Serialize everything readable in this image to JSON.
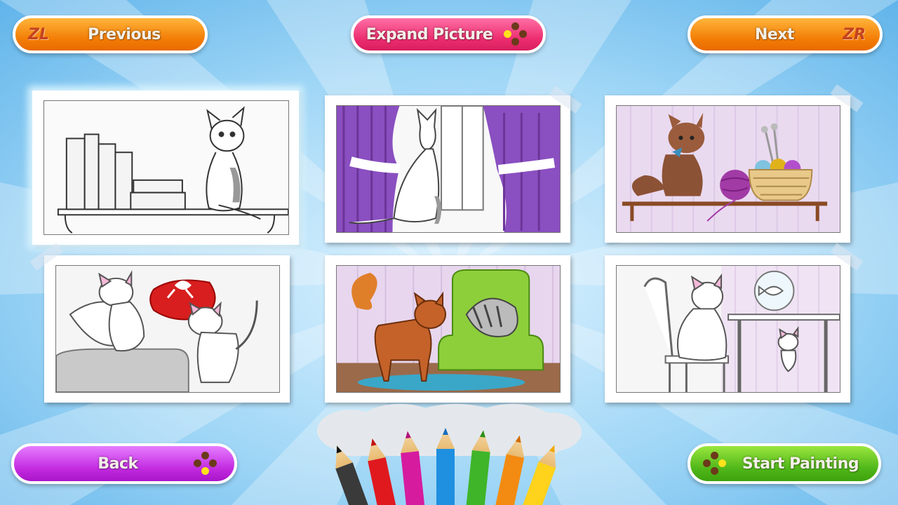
{
  "buttons": {
    "previous": {
      "label": "Previous",
      "shoulder": "ZL"
    },
    "expand": {
      "label": "Expand Picture"
    },
    "next": {
      "label": "Next",
      "shoulder": "ZR"
    },
    "back": {
      "label": "Back"
    },
    "start": {
      "label": "Start Painting"
    }
  },
  "colors": {
    "background": "#7fc4ef",
    "orange": "#f37d06",
    "pink": "#ec2d6f",
    "purple": "#c22ae0",
    "green": "#4fb619"
  },
  "pictures": [
    {
      "name": "cat-on-bookshelf",
      "selected": true
    },
    {
      "name": "cat-by-window-curtains",
      "selected": false
    },
    {
      "name": "kitten-with-yarn",
      "selected": false
    },
    {
      "name": "cats-with-pillow",
      "selected": false
    },
    {
      "name": "cats-in-armchair",
      "selected": false
    },
    {
      "name": "cat-on-chair-with-fishbowl",
      "selected": false
    }
  ],
  "pencils": [
    "black",
    "red",
    "magenta",
    "blue",
    "green",
    "orange",
    "yellow"
  ],
  "icons": {
    "shoulder": "shoulder-button-icon",
    "pad": "button-pad-icon"
  }
}
